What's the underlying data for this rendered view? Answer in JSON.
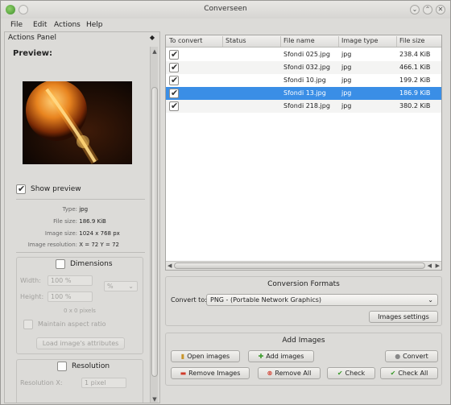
{
  "window": {
    "title": "Converseen"
  },
  "menu": [
    "File",
    "Edit",
    "Actions",
    "Help"
  ],
  "actions_panel": {
    "title": "Actions Panel",
    "preview_label": "Preview:",
    "show_preview_label": "Show preview",
    "show_preview_checked": true,
    "info": {
      "type_label": "Type:",
      "type_value": "jpg",
      "size_label": "File size:",
      "size_value": "186.9 KiB",
      "dim_label": "Image size:",
      "dim_value": "1024 x 768 px",
      "res_label": "Image resolution:",
      "res_value": "X = 72 Y = 72"
    },
    "dimensions": {
      "title": "Dimensions",
      "width_label": "Width:",
      "width_value": "100 %",
      "height_label": "Height:",
      "height_value": "100 %",
      "unit_value": "%",
      "pixels_text": "0 x 0 pixels",
      "maintain_label": "Maintain aspect ratio",
      "load_button": "Load image's attributes"
    },
    "resolution": {
      "title": "Resolution",
      "res_x_label": "Resolution X:",
      "res_x_value": "1 pixel"
    }
  },
  "table": {
    "headers": [
      "To convert",
      "Status",
      "File name",
      "Image type",
      "File size"
    ],
    "rows": [
      {
        "checked": true,
        "status": "",
        "name": "Sfondi 025.jpg",
        "type": "jpg",
        "size": "238.4 KiB",
        "selected": false
      },
      {
        "checked": true,
        "status": "",
        "name": "Sfondi 032.jpg",
        "type": "jpg",
        "size": "466.1 KiB",
        "selected": false
      },
      {
        "checked": true,
        "status": "",
        "name": "Sfondi 10.jpg",
        "type": "jpg",
        "size": "199.2 KiB",
        "selected": false
      },
      {
        "checked": true,
        "status": "",
        "name": "Sfondi 13.jpg",
        "type": "jpg",
        "size": "186.9 KiB",
        "selected": true
      },
      {
        "checked": true,
        "status": "",
        "name": "Sfondi 218.jpg",
        "type": "jpg",
        "size": "380.2 KiB",
        "selected": false
      }
    ]
  },
  "conversion_formats": {
    "title": "Conversion Formats",
    "convert_to_label": "Convert to:",
    "format_value": "PNG - (Portable Network Graphics)",
    "images_settings_button": "Images settings"
  },
  "add_images": {
    "title": "Add Images",
    "open_button": "Open images",
    "add_button": "Add images",
    "convert_button": "Convert",
    "remove_button": "Remove Images",
    "remove_all_button": "Remove All",
    "check_button": "Check",
    "check_all_button": "Check All"
  },
  "colors": {
    "selection": "#3a8ee6",
    "add_icon": "#3a9a2a",
    "remove_icon": "#d03a2a"
  }
}
